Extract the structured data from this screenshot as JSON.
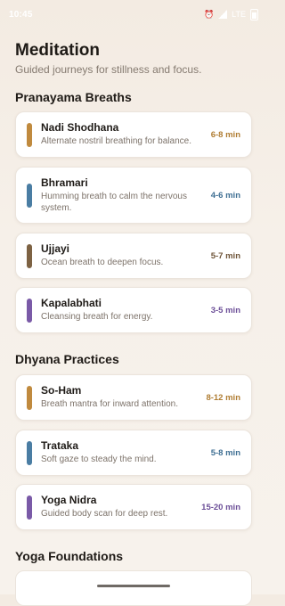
{
  "status_bar": {
    "time": "10:45",
    "icons": [
      "alarm-icon",
      "signal-icon",
      "lte-icon",
      "battery-icon"
    ],
    "network_label": "LTE"
  },
  "header": {
    "title": "Meditation",
    "subtitle": "Guided journeys for stillness and focus."
  },
  "sections": [
    {
      "title": "Pranayama Breaths",
      "items": [
        {
          "name": "Nadi Shodhana",
          "description": "Alternate nostril breathing for balance.",
          "duration": "6-8 min",
          "accent": "#c08a3e"
        },
        {
          "name": "Bhramari",
          "description": "Humming breath to calm the nervous system.",
          "duration": "4-6 min",
          "accent": "#4a7da3"
        },
        {
          "name": "Ujjayi",
          "description": "Ocean breath to deepen focus.",
          "duration": "5-7 min",
          "accent": "#7d6243"
        },
        {
          "name": "Kapalabhati",
          "description": "Cleansing breath for energy.",
          "duration": "3-5 min",
          "accent": "#7a5aa7"
        }
      ]
    },
    {
      "title": "Dhyana Practices",
      "items": [
        {
          "name": "So-Ham",
          "description": "Breath mantra for inward attention.",
          "duration": "8-12 min",
          "accent": "#c08a3e"
        },
        {
          "name": "Trataka",
          "description": "Soft gaze to steady the mind.",
          "duration": "5-8 min",
          "accent": "#4a7da3"
        },
        {
          "name": "Yoga Nidra",
          "description": "Guided body scan for deep rest.",
          "duration": "15-20 min",
          "accent": "#7a5aa7"
        }
      ]
    },
    {
      "title": "Yoga Foundations",
      "items": []
    }
  ]
}
